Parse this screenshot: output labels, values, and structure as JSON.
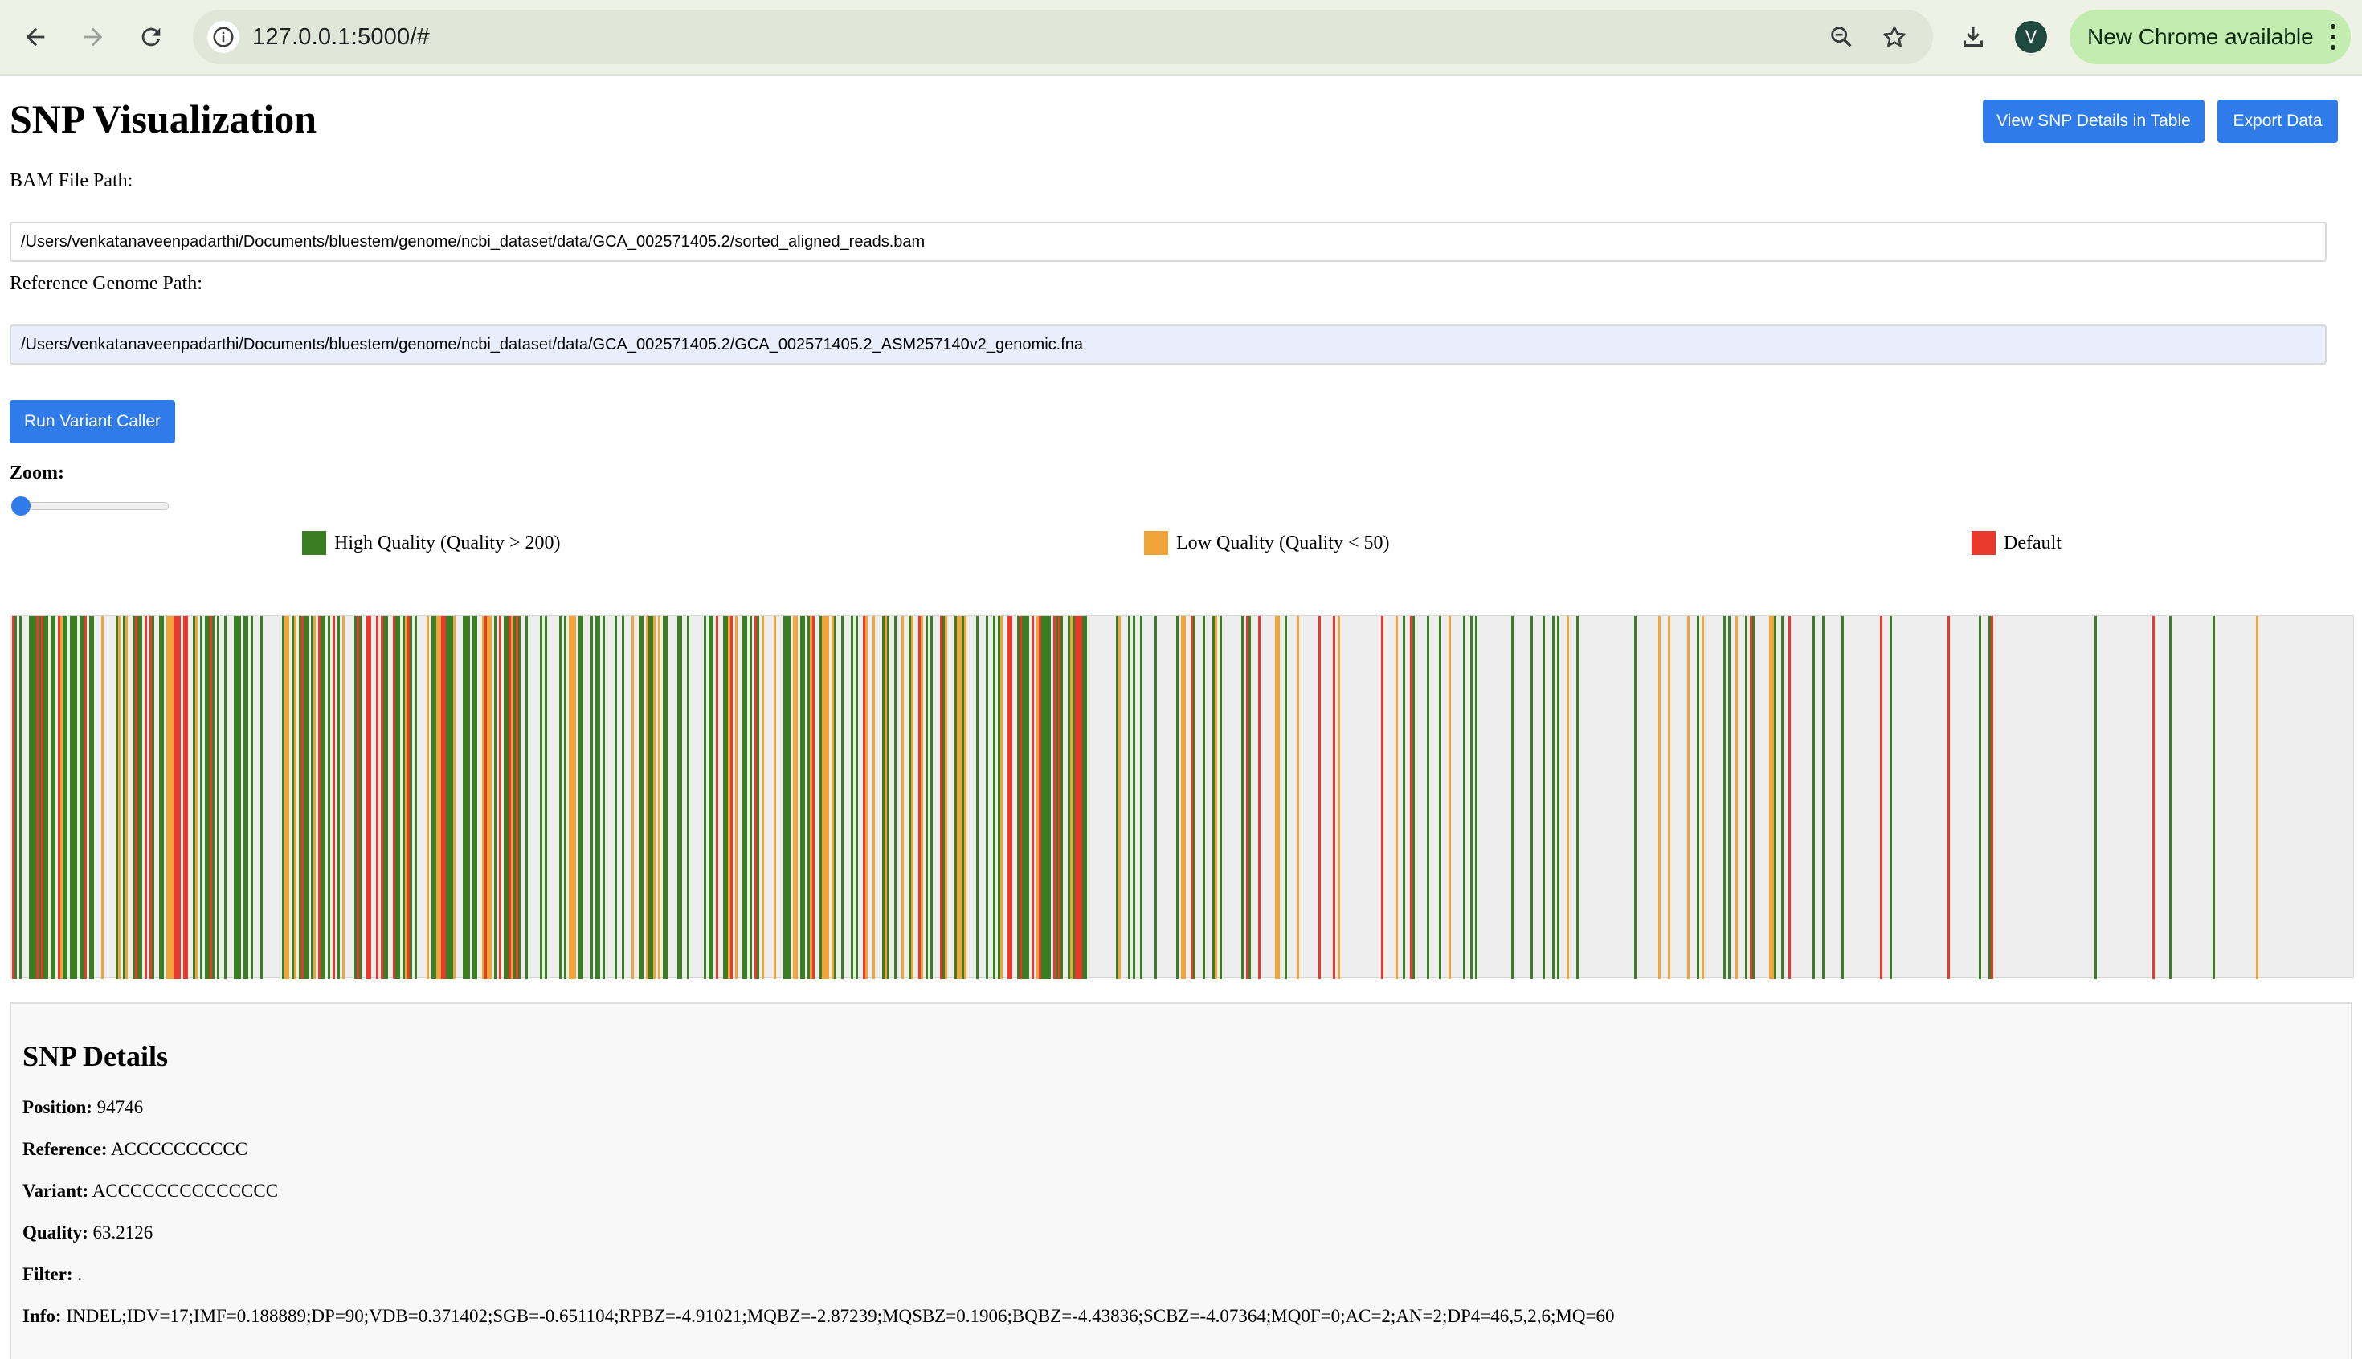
{
  "browser": {
    "url": "127.0.0.1:5000/#",
    "avatar_letter": "V",
    "update_label": "New Chrome available",
    "icons": [
      "back-icon",
      "forward-icon",
      "reload-icon",
      "info-icon",
      "zoom-icon",
      "star-icon",
      "download-icon",
      "more-vert-icon"
    ]
  },
  "page": {
    "title": "SNP Visualization",
    "view_table_label": "View SNP Details in Table",
    "export_label": "Export Data",
    "bam_label": "BAM File Path:",
    "bam_value": "/Users/venkatanaveenpadarthi/Documents/bluestem/genome/ncbi_dataset/data/GCA_002571405.2/sorted_aligned_reads.bam",
    "ref_label": "Reference Genome Path:",
    "ref_value": "/Users/venkatanaveenpadarthi/Documents/bluestem/genome/ncbi_dataset/data/GCA_002571405.2/GCA_002571405.2_ASM257140v2_genomic.fna",
    "run_label": "Run Variant Caller",
    "zoom_label": "Zoom:",
    "zoom_value": 0
  },
  "legend": [
    {
      "label": "High Quality (Quality > 200)",
      "color": "#3a7d22"
    },
    {
      "label": "Low Quality (Quality < 50)",
      "color": "#f0a43a"
    },
    {
      "label": "Default",
      "color": "#e8392c"
    }
  ],
  "colors": {
    "high": "#3a7d22",
    "low": "#f0a43a",
    "default": "#e8392c",
    "accent": "#2f7bea",
    "track_bg": "#eeeeee"
  },
  "details": {
    "heading": "SNP Details",
    "position_label": "Position:",
    "position_value": "94746",
    "reference_label": "Reference:",
    "reference_value": "ACCCCCCCCCC",
    "variant_label": "Variant:",
    "variant_value": "ACCCCCCCCCCCCCC",
    "quality_label": "Quality:",
    "quality_value": "63.2126",
    "filter_label": "Filter:",
    "filter_value": ".",
    "info_label": "Info:",
    "info_value": "INDEL;IDV=17;IMF=0.188889;DP=90;VDB=0.371402;SGB=-0.651104;RPBZ=-4.91021;MQBZ=-2.87239;MQSBZ=0.1906;BQBZ=-4.43836;SCBZ=-4.07364;MQ0F=0;AC=2;AN=2;DP4=46,5,2,6;MQ=60"
  }
}
